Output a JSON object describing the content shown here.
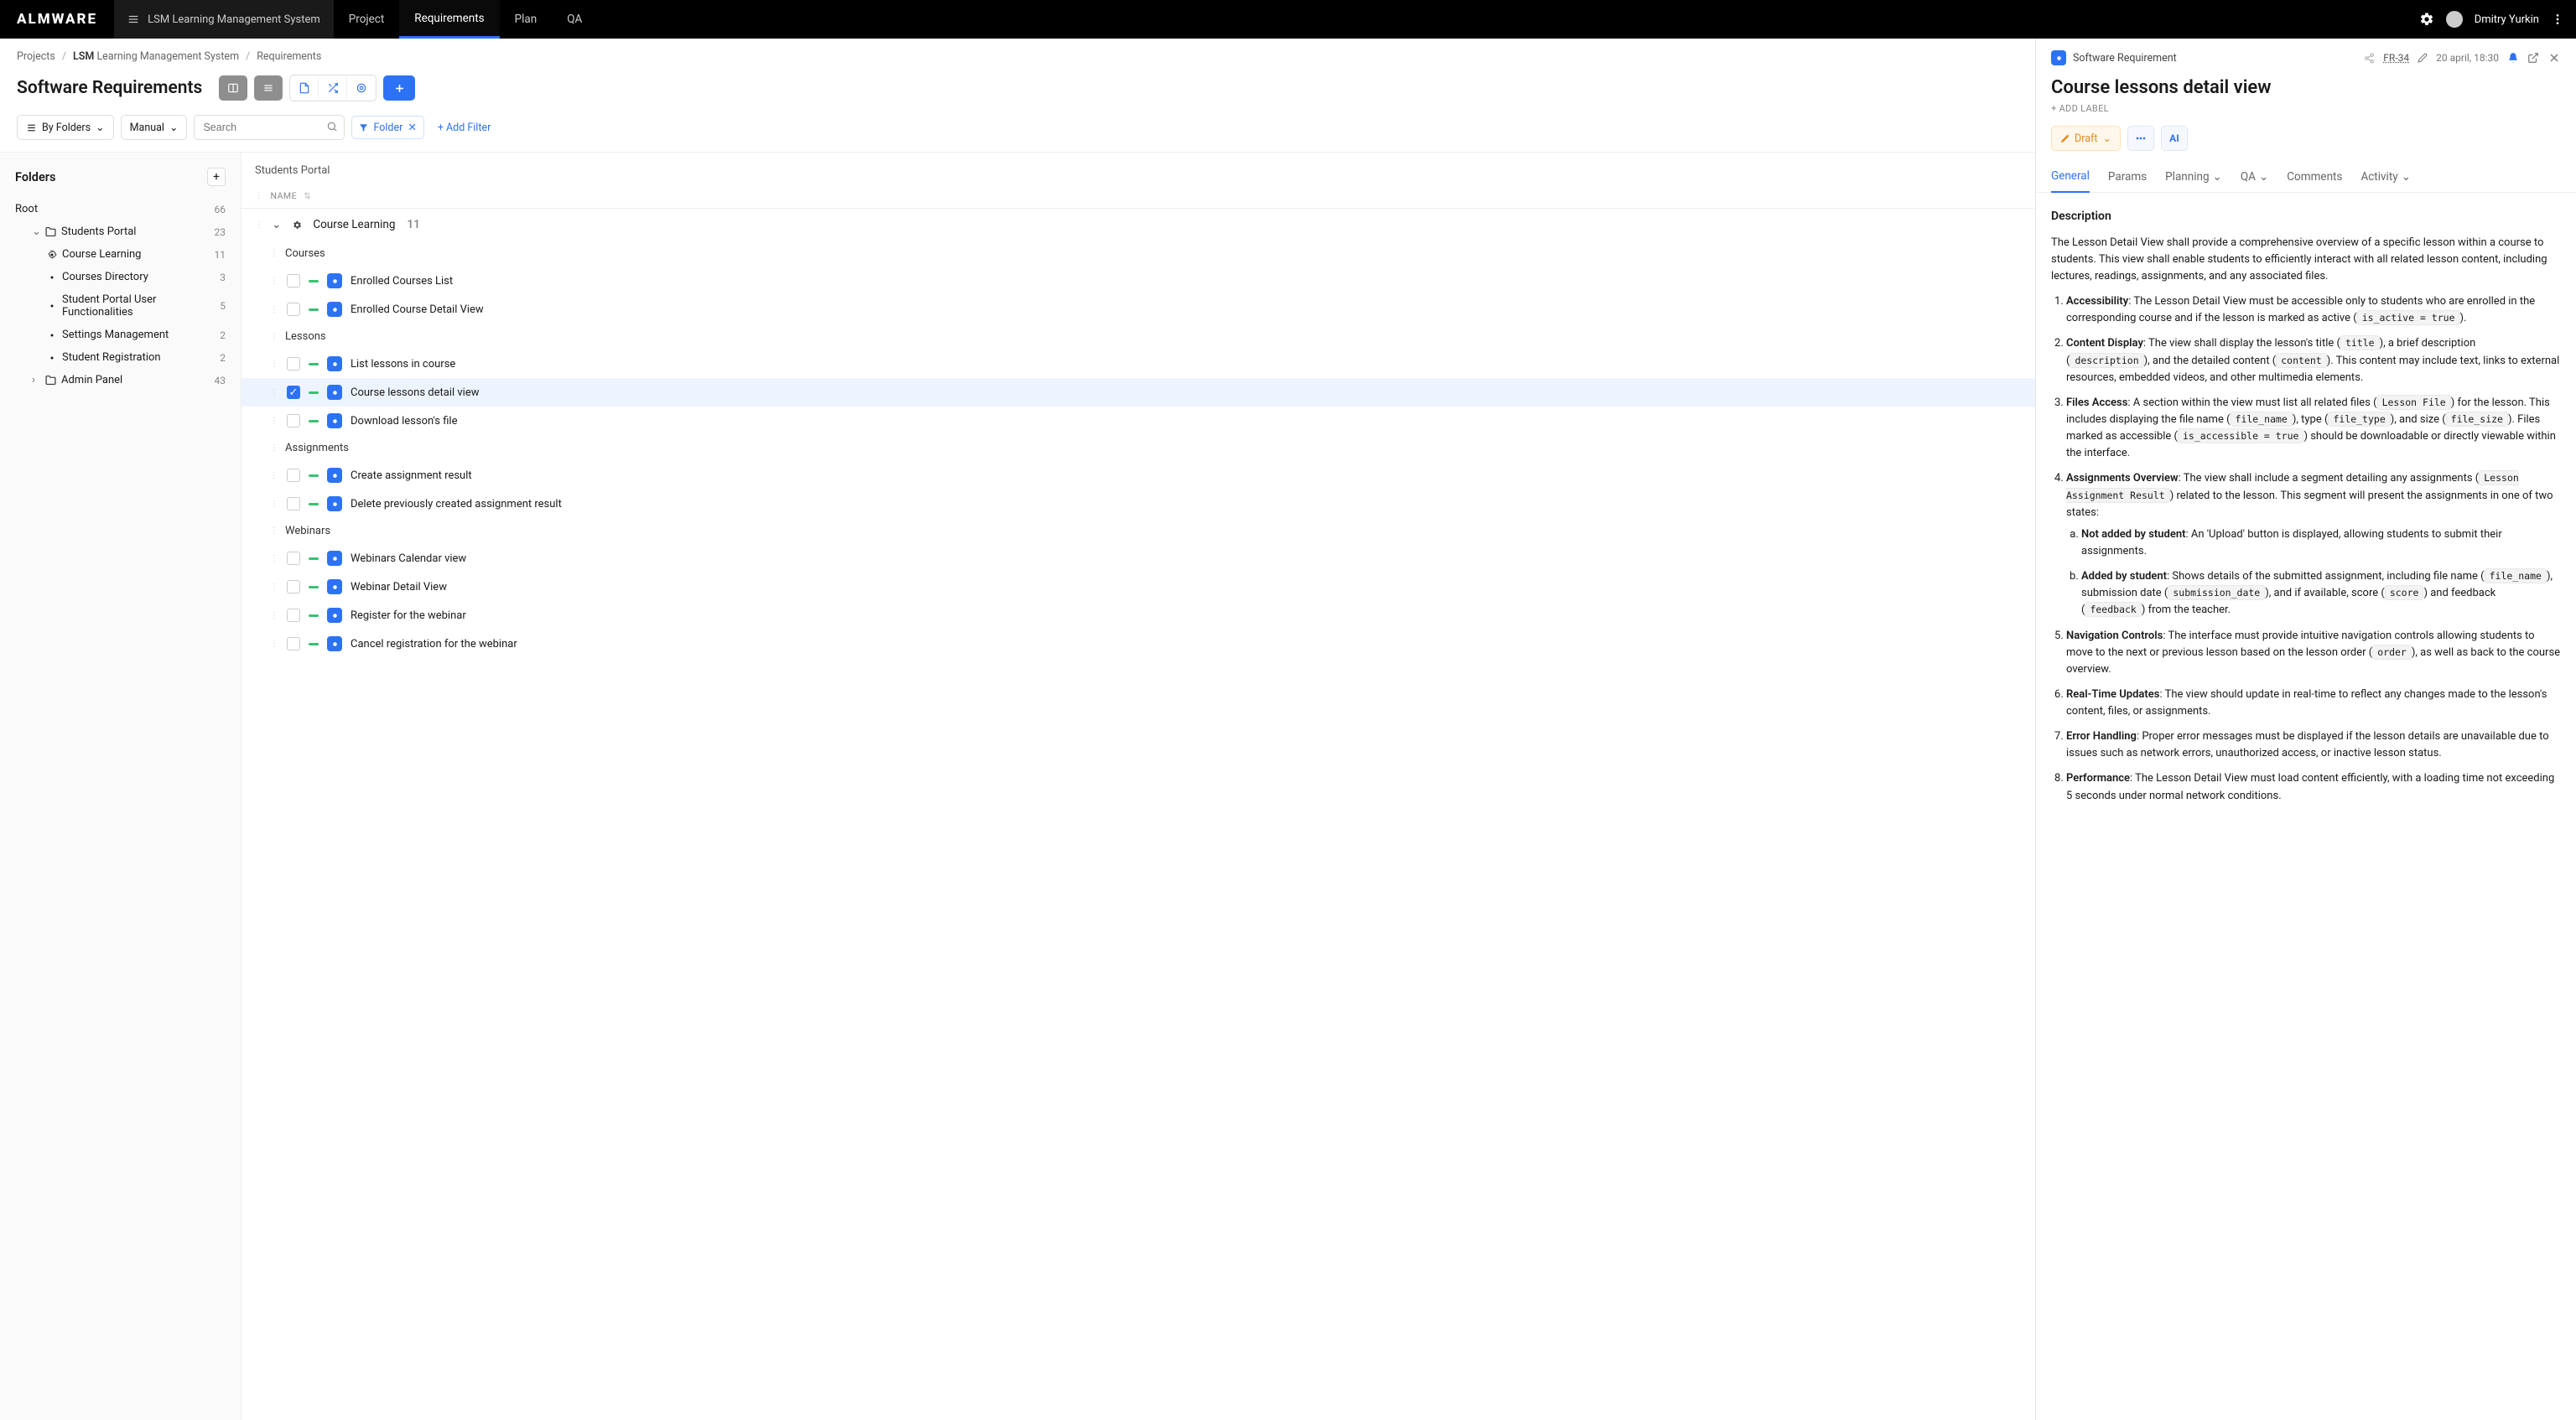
{
  "brand": "ALMWARE",
  "project_switch": "LSM Learning Management System",
  "nav": {
    "project": "Project",
    "requirements": "Requirements",
    "plan": "Plan",
    "qa": "QA"
  },
  "user_name": "Dmitry Yurkin",
  "breadcrumb": {
    "projects": "Projects",
    "proj_code": "LSM",
    "proj_name": "Learning Management System",
    "section": "Requirements"
  },
  "page_title": "Software Requirements",
  "filters": {
    "by_folders": "By Folders",
    "manual": "Manual",
    "search_placeholder": "Search",
    "folder_chip": "Folder",
    "add_filter": "+ Add Filter"
  },
  "folders": {
    "title": "Folders",
    "root": {
      "label": "Root",
      "count": "66"
    },
    "students_portal": {
      "label": "Students Portal",
      "count": "23"
    },
    "course_learning": {
      "label": "Course Learning",
      "count": "11"
    },
    "courses_directory": {
      "label": "Courses Directory",
      "count": "3"
    },
    "user_func": {
      "label": "Student Portal User Functionalities",
      "count": "5"
    },
    "settings_mgmt": {
      "label": "Settings Management",
      "count": "2"
    },
    "student_reg": {
      "label": "Student Registration",
      "count": "2"
    },
    "admin_panel": {
      "label": "Admin Panel",
      "count": "43"
    }
  },
  "list": {
    "header": "Students Portal",
    "col_name": "NAME",
    "group": {
      "label": "Course Learning",
      "count": "11"
    },
    "sub_courses": "Courses",
    "sub_lessons": "Lessons",
    "sub_assignments": "Assignments",
    "sub_webinars": "Webinars",
    "items": {
      "enrolled_list": "Enrolled Courses List",
      "enrolled_detail": "Enrolled Course Detail View",
      "list_lessons": "List lessons in course",
      "lesson_detail": "Course lessons detail view",
      "download_lesson": "Download lesson's file",
      "create_assignment": "Create assignment result",
      "delete_assignment": "Delete previously created assignment result",
      "webinar_calendar": "Webinars Calendar view",
      "webinar_detail": "Webinar Detail View",
      "register_webinar": "Register for the webinar",
      "cancel_webinar": "Cancel registration for the webinar"
    }
  },
  "panel": {
    "type_label": "Software Requirement",
    "id": "FR-34",
    "date": "20 april, 18:30",
    "title": "Course lessons detail view",
    "add_label": "+ ADD LABEL",
    "status": "Draft",
    "tabs": {
      "general": "General",
      "params": "Params",
      "planning": "Planning",
      "qa": "QA",
      "comments": "Comments",
      "activity": "Activity"
    },
    "desc_hd": "Description",
    "intro": "The Lesson Detail View shall provide a comprehensive overview of a specific lesson within a course to students. This view shall enable students to efficiently interact with all related lesson content, including lectures, readings, assignments, and any associated files.",
    "pts": {
      "p1a": "Accessibility",
      "p1b": ": The Lesson Detail View must be accessible only to students who are enrolled in the corresponding course and if the lesson is marked as active (",
      "p1c": "is_active = true",
      "p1d": ").",
      "p2a": "Content Display",
      "p2b": ": The view shall display the lesson's title (",
      "p2c": "title",
      "p2d": "), a brief description (",
      "p2e": "description",
      "p2f": "), and the detailed content (",
      "p2g": "content",
      "p2h": "). This content may include text, links to external resources, embedded videos, and other multimedia elements.",
      "p3a": "Files Access",
      "p3b": ": A section within the view must list all related files (",
      "p3c": "Lesson File",
      "p3d": ") for the lesson. This includes displaying the file name (",
      "p3e": "file_name",
      "p3f": "), type (",
      "p3g": "file_type",
      "p3h": "), and size (",
      "p3i": "file_size",
      "p3j": "). Files marked as accessible (",
      "p3k": "is_accessible = true",
      "p3l": ") should be downloadable or directly viewable within the interface.",
      "p4a": "Assignments Overview",
      "p4b": ": The view shall include a segment detailing any assignments (",
      "p4c": "Lesson Assignment Result",
      "p4d": ") related to the lesson. This segment will present the assignments in one of two states:",
      "p4sa": "Not added by student",
      "p4sb": ": An 'Upload' button is displayed, allowing students to submit their assignments.",
      "p4sc": "Added by student",
      "p4sd": ": Shows details of the submitted assignment, including file name (",
      "p4se": "file_name",
      "p4sf": "), submission date (",
      "p4sg": "submission_date",
      "p4sh": "), and if available, score (",
      "p4si": "score",
      "p4sj": ") and feedback (",
      "p4sk": "feedback",
      "p4sl": ") from the teacher.",
      "p5a": "Navigation Controls",
      "p5b": ": The interface must provide intuitive navigation controls allowing students to move to the next or previous lesson based on the lesson order (",
      "p5c": "order",
      "p5d": "), as well as back to the course overview.",
      "p6a": "Real-Time Updates",
      "p6b": ": The view should update in real-time to reflect any changes made to the lesson's content, files, or assignments.",
      "p7a": "Error Handling",
      "p7b": ": Proper error messages must be displayed if the lesson details are unavailable due to issues such as network errors, unauthorized access, or inactive lesson status.",
      "p8a": "Performance",
      "p8b": ": The Lesson Detail View must load content efficiently, with a loading time not exceeding 5 seconds under normal network conditions."
    }
  }
}
